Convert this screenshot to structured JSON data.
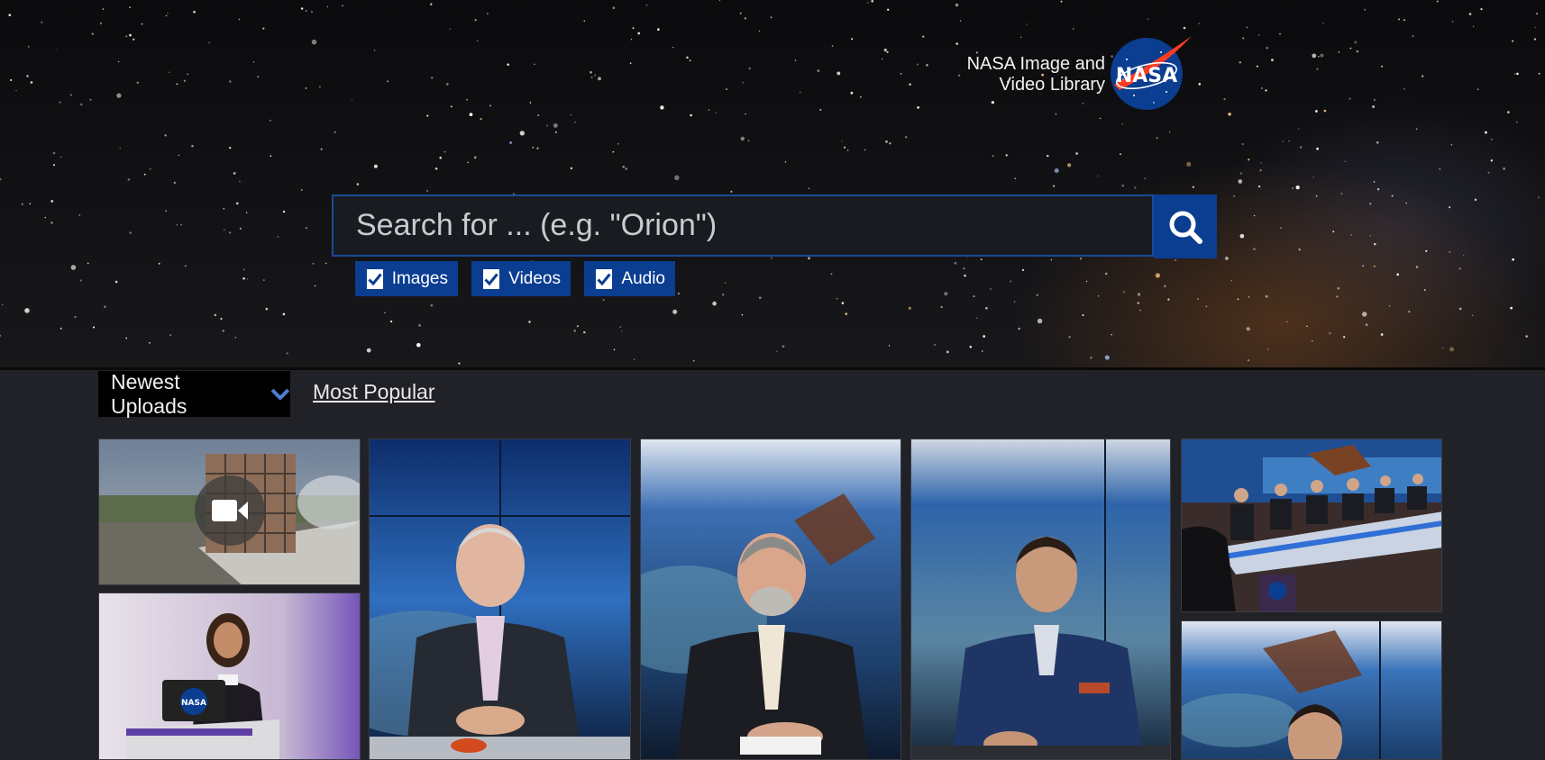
{
  "brand": {
    "line1": "NASA Image and",
    "line2": "Video Library",
    "logo_text": "NASA"
  },
  "search": {
    "placeholder": "Search for ... (e.g. \"Orion\")",
    "button_icon": "search-icon"
  },
  "filters": [
    {
      "label": "Images",
      "checked": true
    },
    {
      "label": "Videos",
      "checked": true
    },
    {
      "label": "Audio",
      "checked": true
    }
  ],
  "tabs": {
    "newest": "Newest Uploads",
    "newest_icon": "chevron-down-icon",
    "popular": "Most Popular"
  },
  "gallery": [
    {
      "type": "video",
      "subject": "building",
      "icon": "video-camera-icon"
    },
    {
      "type": "image",
      "subject": "speaker at podium"
    },
    {
      "type": "image",
      "subject": "panelist portrait"
    },
    {
      "type": "image",
      "subject": "panelist portrait"
    },
    {
      "type": "image",
      "subject": "panelist portrait"
    },
    {
      "type": "image",
      "subject": "panel table"
    },
    {
      "type": "image",
      "subject": "panelist portrait"
    }
  ],
  "colors": {
    "accent": "#0b3d91",
    "background": "#212227",
    "nasa_red": "#fc3d21"
  }
}
